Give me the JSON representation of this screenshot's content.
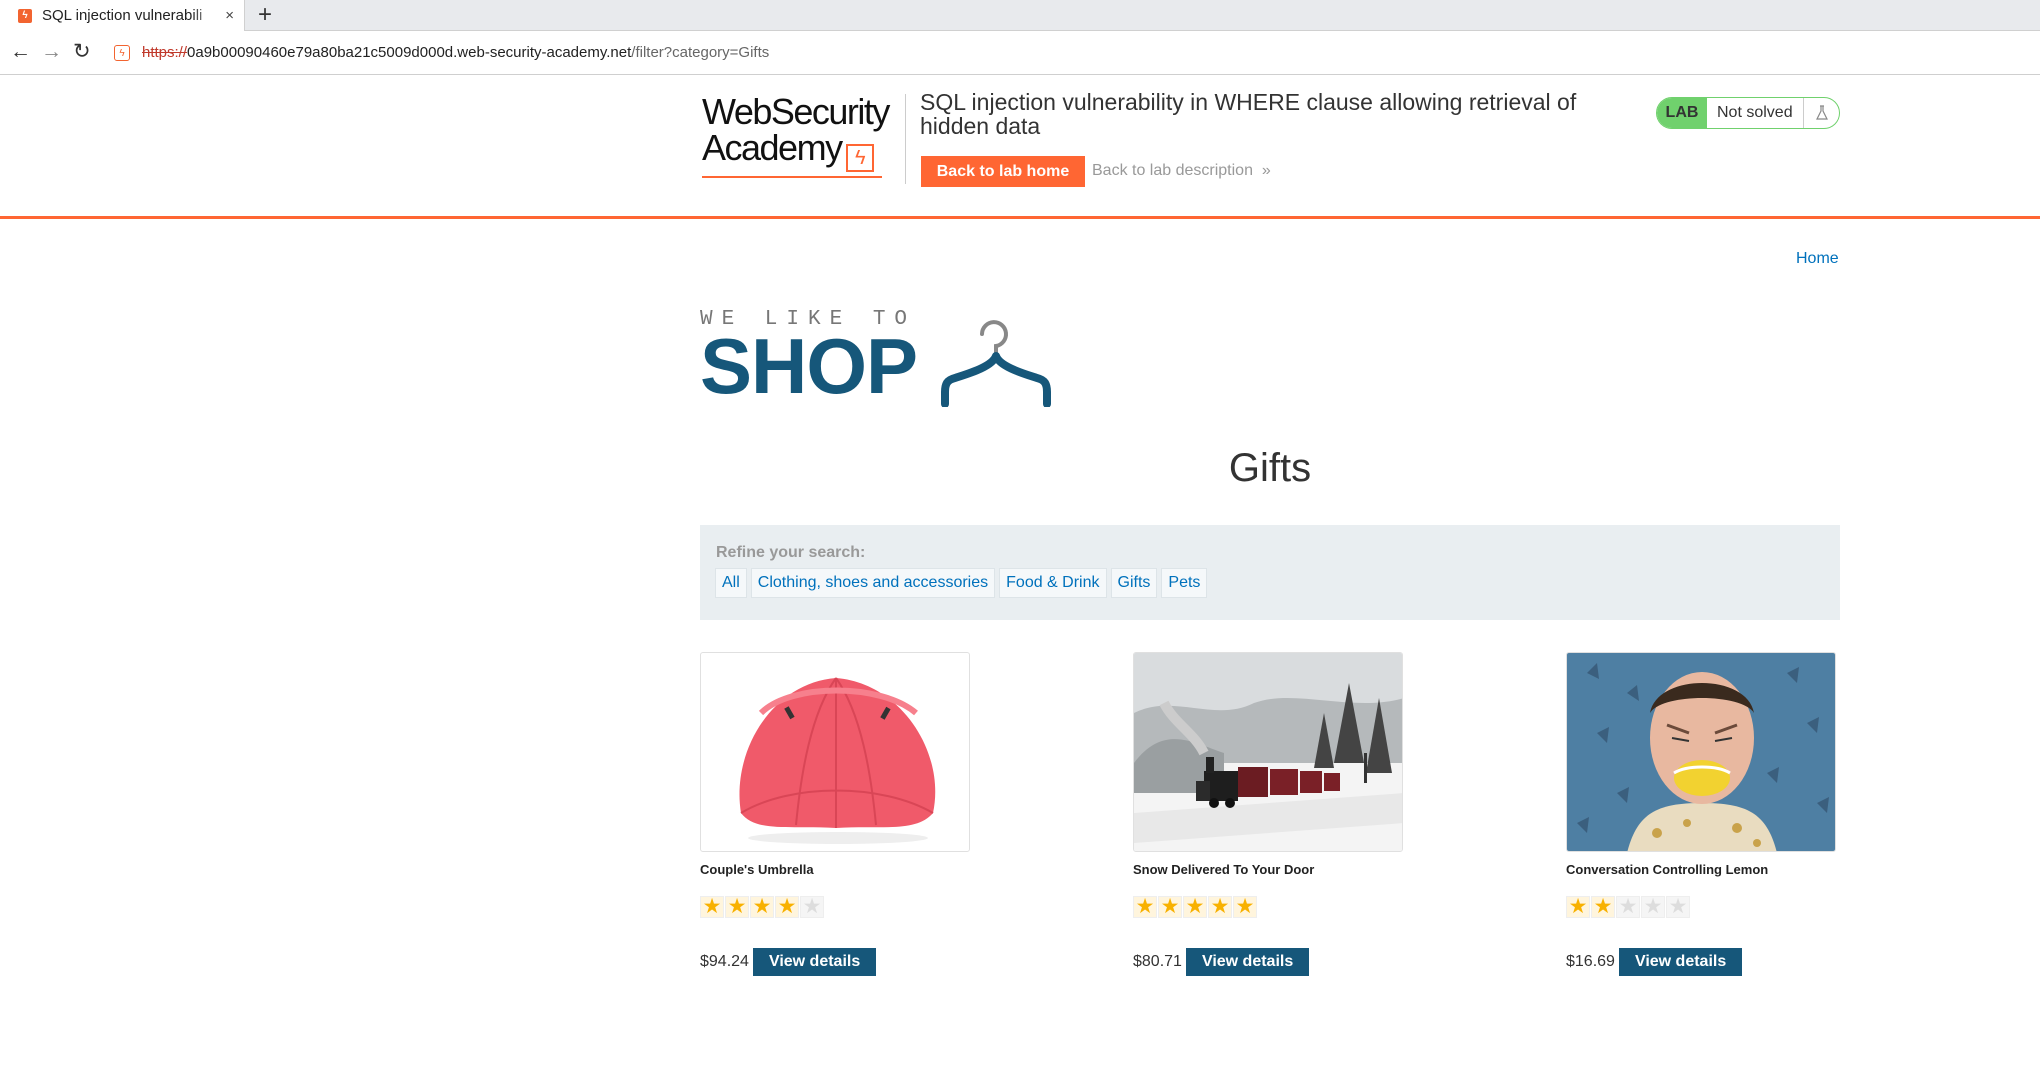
{
  "browser": {
    "tab_title": "SQL injection vulnerabili",
    "tab_favicon": "ws-logo-icon",
    "new_tab_label": "+",
    "close_label": "×",
    "url_scheme": "https://",
    "url_host": "0a9b00090460e79a80ba21c5009d000d.web-security-academy.net",
    "url_path": "/filter?category=Gifts"
  },
  "lab": {
    "logo_line1": "WebSecurity",
    "logo_line2": "Academy",
    "logo_bolt": "ϟ",
    "title": "SQL injection vulnerability in WHERE clause allowing retrieval of hidden data",
    "back_home": "Back to lab home",
    "back_desc": "Back to lab description",
    "status_tag": "LAB",
    "status": "Not solved",
    "accent": "#ff6633",
    "solved_color": "#70d16d"
  },
  "nav": {
    "home": "Home"
  },
  "shop_logo": {
    "small": "WE LIKE TO",
    "big": "SHOP"
  },
  "heading": "Gifts",
  "refine": {
    "label": "Refine your search:",
    "filters": [
      "All",
      "Clothing, shoes and accessories",
      "Food & Drink",
      "Gifts",
      "Pets"
    ]
  },
  "products": [
    {
      "name": "Couple's Umbrella",
      "rating": 4,
      "price": "$94.24",
      "button": "View details"
    },
    {
      "name": "Snow Delivered To Your Door",
      "rating": 5,
      "price": "$80.71",
      "button": "View details"
    },
    {
      "name": "Conversation Controlling Lemon",
      "rating": 2,
      "price": "$16.69",
      "button": "View details"
    }
  ]
}
